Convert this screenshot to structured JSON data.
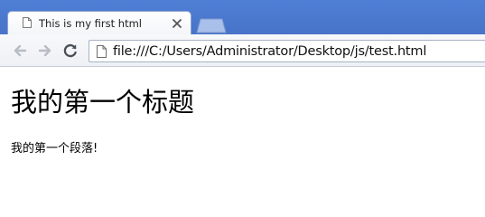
{
  "browser": {
    "tab": {
      "title": "This is my first html",
      "icon": "page-icon",
      "close_icon": "close-icon"
    },
    "new_tab_icon": "new-tab-icon",
    "toolbar": {
      "back_icon": "back-arrow-icon",
      "forward_icon": "forward-arrow-icon",
      "reload_icon": "reload-icon",
      "address": "file:///C:/Users/Administrator/Desktop/js/test.html",
      "address_icon": "page-icon"
    },
    "colors": {
      "tabstrip": "#4a78cd",
      "toolbar": "#f2f4f7"
    }
  },
  "page": {
    "heading": "我的第一个标题",
    "paragraph": "我的第一个段落!"
  }
}
